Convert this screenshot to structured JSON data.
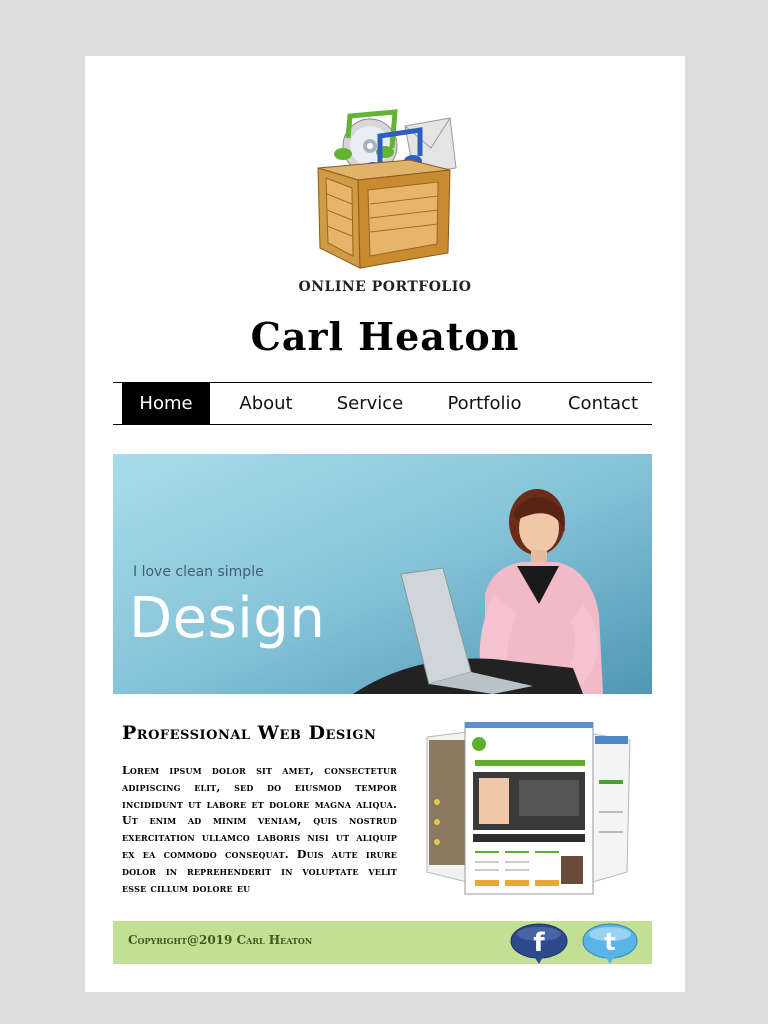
{
  "header": {
    "tagline": "ONLINE PORTFOLIO",
    "site_name": "Carl Heaton"
  },
  "nav": {
    "items": [
      {
        "label": "Home",
        "active": true
      },
      {
        "label": "About",
        "active": false
      },
      {
        "label": "Service",
        "active": false
      },
      {
        "label": "Portfolio",
        "active": false
      },
      {
        "label": "Contact",
        "active": false
      }
    ]
  },
  "hero": {
    "small_text": "I love clean simple",
    "big_text": "Design"
  },
  "section": {
    "title": "Professional Web Design",
    "body": "Lorem ipsum dolor sit amet, consectetur adipiscing elit, sed do eiusmod tempor incididunt ut labore et dolore magna aliqua. Ut enim ad minim veniam, quis nostrud exercitation ullamco laboris nisi ut aliquip ex ea commodo consequat. Duis aute irure dolor in reprehenderit in voluptate velit esse cillum dolore eu"
  },
  "mockup": {
    "site_name": "Web Courses Bangkok",
    "left_label": "Web",
    "right_label": "ok",
    "feature_label": "Acting Coach"
  },
  "footer": {
    "copyright": "Copyright@2019 Carl Heaton",
    "social": [
      {
        "icon": "facebook-icon",
        "glyph": "f",
        "color": "#2d4a8c"
      },
      {
        "icon": "twitter-icon",
        "glyph": "t",
        "color": "#5ab4e8"
      }
    ]
  },
  "colors": {
    "page_bg": "#dcdcdc",
    "content_bg": "#ffffff",
    "nav_active_bg": "#000000",
    "footer_bg": "#c2df94",
    "hero_bg": "#8ccbe0"
  }
}
